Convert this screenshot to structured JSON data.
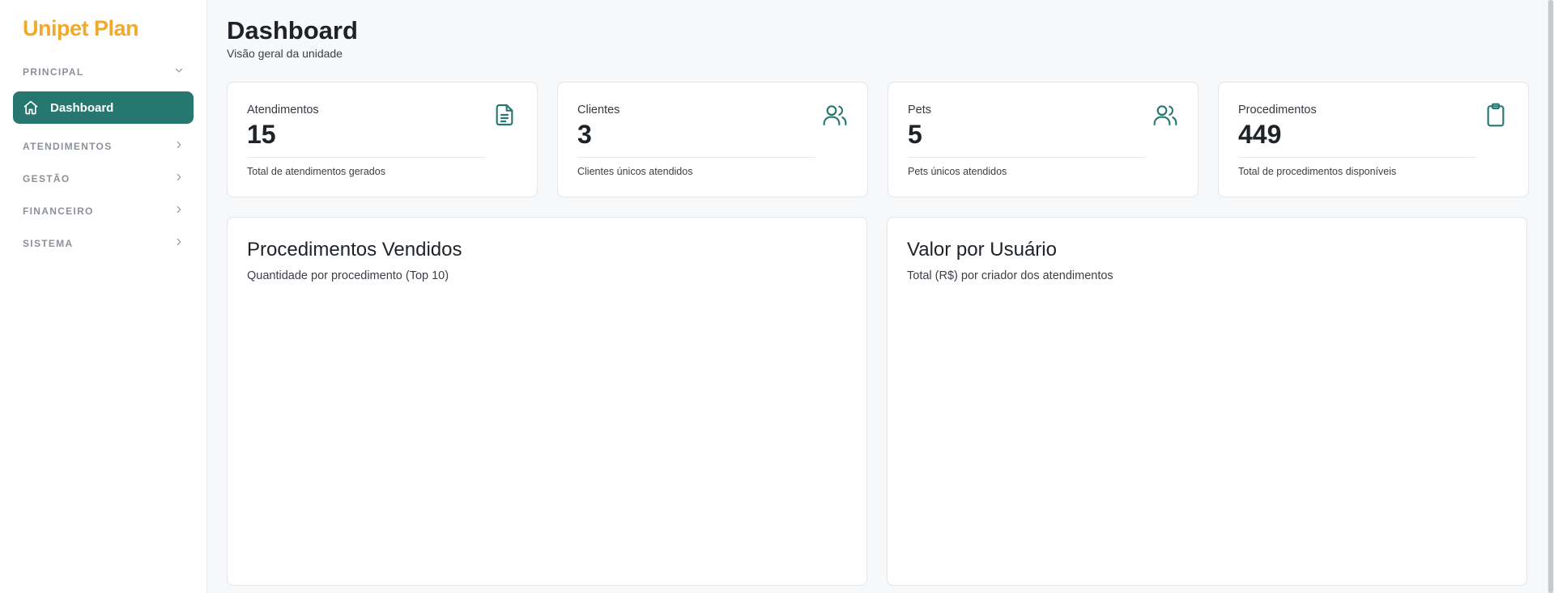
{
  "app": {
    "logo_text": "Unipet Plan",
    "brand_color": "#f0a92a",
    "accent_color": "#267770"
  },
  "sidebar": {
    "sections": [
      {
        "label": "PRINCIPAL",
        "icon": "chevron-down-icon",
        "expanded": true
      },
      {
        "label": "ATENDIMENTOS",
        "icon": "chevron-right-icon",
        "expanded": false
      },
      {
        "label": "GESTÃO",
        "icon": "chevron-right-icon",
        "expanded": false
      },
      {
        "label": "FINANCEIRO",
        "icon": "chevron-right-icon",
        "expanded": false
      },
      {
        "label": "SISTEMA",
        "icon": "chevron-right-icon",
        "expanded": false
      }
    ],
    "active_item": {
      "label": "Dashboard",
      "icon": "home-icon"
    }
  },
  "header": {
    "title": "Dashboard",
    "subtitle": "Visão geral da unidade"
  },
  "stats": [
    {
      "label": "Atendimentos",
      "value": "15",
      "description": "Total de atendimentos gerados",
      "icon": "document-icon"
    },
    {
      "label": "Clientes",
      "value": "3",
      "description": "Clientes únicos atendidos",
      "icon": "users-icon"
    },
    {
      "label": "Pets",
      "value": "5",
      "description": "Pets únicos atendidos",
      "icon": "users-icon"
    },
    {
      "label": "Procedimentos",
      "value": "449",
      "description": "Total de procedimentos disponíveis",
      "icon": "clipboard-icon"
    }
  ],
  "charts": [
    {
      "title": "Procedimentos Vendidos",
      "subtitle": "Quantidade por procedimento (Top 10)"
    },
    {
      "title": "Valor por Usuário",
      "subtitle": "Total (R$) por criador dos atendimentos"
    }
  ]
}
